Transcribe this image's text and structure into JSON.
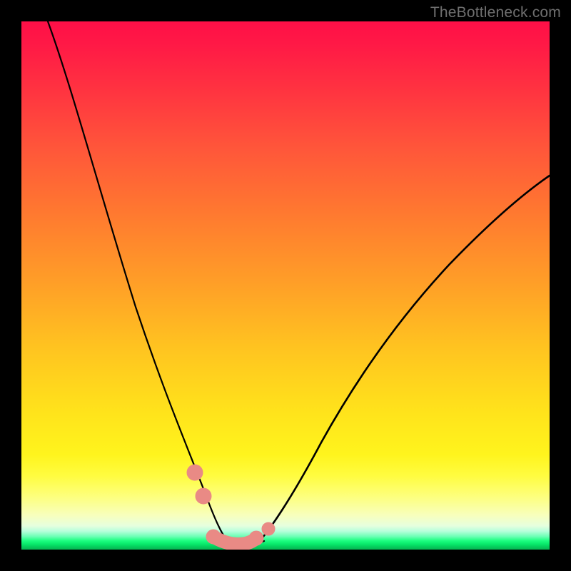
{
  "watermark": "TheBottleneck.com",
  "colors": {
    "background": "#000000",
    "gradient_top": "#ff0f47",
    "gradient_mid": "#ffe31b",
    "gradient_bottom": "#06b452",
    "curve": "#000000",
    "marker": "#e98a85"
  },
  "chart_data": {
    "type": "line",
    "title": "",
    "xlabel": "",
    "ylabel": "",
    "xlim": [
      0,
      100
    ],
    "ylim": [
      0,
      100
    ],
    "annotations": [],
    "grid": false,
    "legend": false,
    "series": [
      {
        "name": "left-branch",
        "x": [
          5,
          8,
          12,
          16,
          20,
          24,
          27,
          30,
          32.5,
          35,
          37
        ],
        "y": [
          100,
          91,
          79,
          67,
          55,
          42,
          31,
          21,
          13,
          6,
          1
        ]
      },
      {
        "name": "right-branch",
        "x": [
          45,
          48,
          52,
          57,
          63,
          70,
          78,
          87,
          95,
          100
        ],
        "y": [
          1,
          5,
          12,
          20,
          30,
          40,
          50,
          59,
          66,
          70
        ]
      },
      {
        "name": "valley-floor",
        "x": [
          37,
          40,
          43,
          45
        ],
        "y": [
          1,
          0.5,
          0.6,
          1
        ]
      }
    ],
    "markers": [
      {
        "name": "left-marker-upper",
        "x": 32.5,
        "y": 13,
        "r": 1.4
      },
      {
        "name": "left-marker-lower",
        "x": 34.0,
        "y": 8.5,
        "r": 1.4
      },
      {
        "name": "right-marker",
        "x": 46.5,
        "y": 3.0,
        "r": 1.2
      },
      {
        "name": "valley-start",
        "x": 36.0,
        "y": 2.6,
        "r": 1.3
      },
      {
        "name": "valley-end",
        "x": 44.0,
        "y": 2.2,
        "r": 1.3
      }
    ],
    "valley_link": {
      "x1": 36.0,
      "y1": 2.6,
      "x2": 44.0,
      "y2": 2.2
    }
  }
}
